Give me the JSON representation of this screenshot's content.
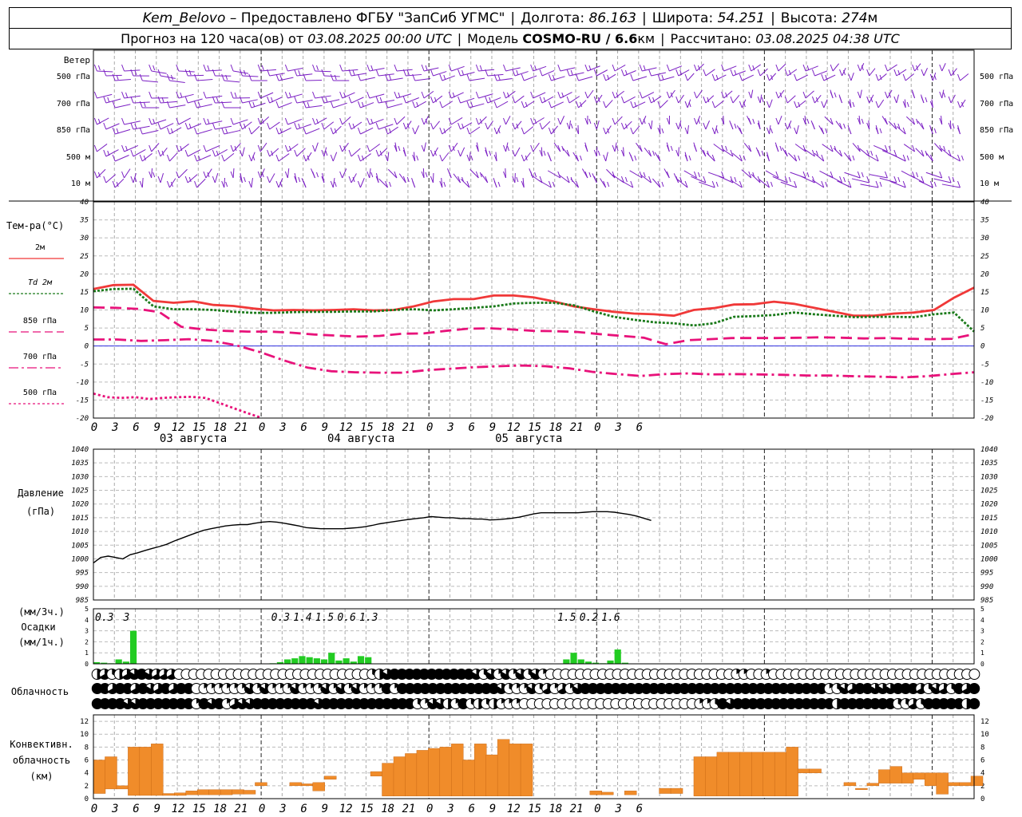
{
  "header": {
    "station": "Kem_Belovo",
    "provided": "– Предоставлено ФГБУ \"ЗапСиб УГМС\"",
    "lon_label": "Долгота:",
    "lon": "86.163",
    "lat_label": "Широта:",
    "lat": "54.251",
    "alt_label": "Высота:",
    "alt": "274",
    "alt_unit": "м",
    "forecast_text": "Прогноз на 120 часа(ов) от",
    "forecast_start": "03.08.2025 00:00 UTC",
    "model_label": "Модель",
    "model": "COSMO-RU / 6.6",
    "model_unit": "км",
    "calc_label": "Рассчитано:",
    "calc_time": "03.08.2025 04:38 UTC"
  },
  "wind_panel": {
    "title": "Ветер",
    "levels": [
      "500 гПа",
      "700 гПа",
      "850 гПа",
      "500 м",
      "10 м"
    ]
  },
  "time_axis": {
    "tick_labels": [
      "0",
      "3",
      "6",
      "9",
      "12",
      "15",
      "18",
      "21",
      "0",
      "3",
      "6",
      "9",
      "12",
      "15",
      "18",
      "21",
      "0",
      "3",
      "6",
      "9",
      "12",
      "15",
      "18",
      "21",
      "0",
      "3",
      "6"
    ],
    "days": [
      "03 августа",
      "04 августа",
      "05 августа"
    ]
  },
  "colors": {
    "wind": "#7b1fc4",
    "t2m": "#f03838",
    "td2m": "#1a7a1a",
    "t850": "#e8127a",
    "t700": "#e8127a",
    "t500": "#e8127a",
    "pressure": "#000000",
    "precip": "#22cc22",
    "conv": "#f08c2a",
    "zero_line": "#3030e0"
  },
  "chart_data": [
    {
      "type": "line",
      "title": "Тем-ра(°C)",
      "x_hours": [
        0,
        3,
        6,
        9,
        12,
        15,
        18,
        21,
        24,
        27,
        30,
        33,
        36,
        39,
        42,
        45,
        48,
        51,
        54,
        57,
        60,
        63,
        66,
        69,
        72,
        75,
        78,
        81,
        84,
        87,
        90,
        93,
        96,
        99,
        102,
        105,
        108,
        111,
        114,
        117,
        120
      ],
      "ylim": [
        -20,
        40
      ],
      "yticks": [
        -20,
        -15,
        -10,
        -5,
        0,
        5,
        10,
        15,
        20,
        25,
        30,
        35,
        40
      ],
      "series": [
        {
          "name": "2м",
          "key": "t2m",
          "values": [
            15.8,
            16.9,
            17.0,
            12.5,
            12.0,
            12.4,
            11.4,
            11.1,
            10.4,
            9.9,
            10.0,
            9.9,
            10.0,
            10.2,
            9.9,
            10.0,
            11.0,
            12.4,
            13.0,
            13.0,
            14.0,
            14.0,
            13.5,
            12.4,
            11.0,
            10.2,
            9.5,
            9.0,
            8.8,
            8.4,
            10.0,
            10.5,
            11.5,
            11.6,
            12.3,
            11.7,
            10.6,
            9.5,
            8.4,
            8.4,
            9.0,
            9.3,
            10.0,
            13.4,
            16.2
          ]
        },
        {
          "name": "Td 2м",
          "key": "td2m",
          "values": [
            15.2,
            15.8,
            15.9,
            11.0,
            10.2,
            10.2,
            10.0,
            9.5,
            9.2,
            9.2,
            9.4,
            9.5,
            9.5,
            9.6,
            9.6,
            10.0,
            10.2,
            9.9,
            10.2,
            10.6,
            11.0,
            11.8,
            12.0,
            12.0,
            11.3,
            9.6,
            8.1,
            7.3,
            6.6,
            6.3,
            5.7,
            6.3,
            8.1,
            8.3,
            8.6,
            9.3,
            8.8,
            8.4,
            8.0,
            8.1,
            8.1,
            8.0,
            8.8,
            9.3,
            4.0
          ]
        },
        {
          "name": "850 гПа",
          "key": "t850",
          "values": [
            10.7,
            10.6,
            10.3,
            9.4,
            5.3,
            4.6,
            4.2,
            4.0,
            4.0,
            3.7,
            3.2,
            2.9,
            2.6,
            2.8,
            3.4,
            3.5,
            4.2,
            4.8,
            4.9,
            4.6,
            4.2,
            4.1,
            3.9,
            3.3,
            2.8,
            2.3,
            0.5,
            1.6,
            1.9,
            2.2,
            2.2,
            2.2,
            2.3,
            2.4,
            2.3,
            2.1,
            2.2,
            2.0,
            1.9,
            2.0,
            3.3
          ]
        },
        {
          "name": "700 гПа",
          "key": "t700",
          "values": [
            1.8,
            1.8,
            1.4,
            1.6,
            1.9,
            1.4,
            0.2,
            -1.7,
            -4.0,
            -6.0,
            -7.0,
            -7.3,
            -7.4,
            -7.4,
            -6.7,
            -6.3,
            -5.9,
            -5.6,
            -5.4,
            -5.6,
            -6.2,
            -7.2,
            -7.8,
            -8.3,
            -7.8,
            -7.6,
            -7.9,
            -7.8,
            -7.9,
            -8.0,
            -8.2,
            -8.2,
            -8.4,
            -8.5,
            -8.7,
            -8.4,
            -7.8,
            -7.3
          ]
        },
        {
          "name": "500 гПа",
          "key": "t500",
          "values": [
            -13.2,
            -14.2,
            -14.4,
            -14.2,
            -14.7,
            -14.4,
            -14.2,
            -14.1,
            -14.4,
            -15.8,
            -17.2,
            -18.6,
            -19.9
          ]
        }
      ]
    },
    {
      "type": "line",
      "title": "Давление (гПа)",
      "ylim": [
        985,
        1040
      ],
      "yticks": [
        985,
        990,
        995,
        1000,
        1005,
        1010,
        1015,
        1020,
        1025,
        1030,
        1035,
        1040
      ],
      "series": [
        {
          "name": "Давление",
          "key": "pressure",
          "x_hours": [
            0,
            1,
            2,
            3,
            4,
            5,
            6,
            7,
            8,
            9,
            10,
            11,
            12,
            13,
            14,
            15,
            16,
            17,
            18,
            19,
            20,
            21,
            22,
            23,
            24,
            25,
            26,
            27,
            28,
            29,
            30,
            31,
            32,
            33,
            34,
            35,
            36,
            37,
            38,
            39,
            40,
            41,
            42,
            43,
            44,
            45,
            46,
            47,
            48,
            49,
            50,
            51,
            52,
            53,
            54,
            55,
            56,
            57,
            58,
            59,
            60,
            61,
            62,
            63,
            64,
            65,
            66,
            67,
            68,
            69,
            70,
            71,
            72,
            73,
            74,
            75,
            76,
            77,
            78,
            79,
            80,
            81,
            82,
            83,
            84,
            85,
            86,
            87,
            88,
            89,
            90,
            91,
            92,
            93,
            94,
            95,
            96,
            97,
            98,
            99,
            100,
            101,
            102,
            103,
            104,
            105,
            106,
            107,
            108,
            109,
            110,
            111,
            112,
            113,
            114,
            115,
            116,
            117,
            118,
            119,
            120
          ],
          "values": [
            998.5,
            1000.5,
            1001.0,
            1000.5,
            1000.0,
            1001.5,
            1002.2,
            1003.0,
            1003.8,
            1004.5,
            1005.3,
            1006.5,
            1007.5,
            1008.5,
            1009.5,
            1010.4,
            1011.0,
            1011.5,
            1012.0,
            1012.3,
            1012.5,
            1012.5,
            1013.0,
            1013.4,
            1013.6,
            1013.4,
            1013.0,
            1012.5,
            1012.0,
            1011.4,
            1011.2,
            1011.0,
            1011.0,
            1011.0,
            1011.0,
            1011.2,
            1011.4,
            1011.7,
            1012.2,
            1012.8,
            1013.2,
            1013.6,
            1014.0,
            1014.4,
            1014.7,
            1015.0,
            1015.4,
            1015.2,
            1015.0,
            1015.0,
            1014.7,
            1014.7,
            1014.5,
            1014.5,
            1014.2,
            1014.3,
            1014.5,
            1014.8,
            1015.2,
            1015.8,
            1016.4,
            1016.8,
            1016.8,
            1016.8,
            1016.8,
            1016.8,
            1016.8,
            1017.0,
            1017.2,
            1017.2,
            1017.2,
            1017.0,
            1016.6,
            1016.2,
            1015.6,
            1014.8,
            1014.0
          ]
        }
      ]
    },
    {
      "type": "bar",
      "title": "Осадки",
      "ylabel_top": "(мм/3ч.)",
      "ylabel_bottom": "(мм/1ч.)",
      "ylim": [
        0,
        5
      ],
      "yticks": [
        0,
        1,
        2,
        3,
        4,
        5
      ],
      "labels_3h": [
        {
          "hour": 1.5,
          "text": "0.3"
        },
        {
          "hour": 4.5,
          "text": "3"
        },
        {
          "hour": 25.5,
          "text": "0.3"
        },
        {
          "hour": 28.5,
          "text": "1.4"
        },
        {
          "hour": 31.5,
          "text": "1.5"
        },
        {
          "hour": 34.5,
          "text": "0.6"
        },
        {
          "hour": 37.5,
          "text": "1.3"
        },
        {
          "hour": 64.5,
          "text": "1.5"
        },
        {
          "hour": 67.5,
          "text": "0.2"
        },
        {
          "hour": 70.5,
          "text": "1.6"
        }
      ],
      "hourly_mm": [
        {
          "hour": 0,
          "value": 0.15
        },
        {
          "hour": 1,
          "value": 0.1
        },
        {
          "hour": 2,
          "value": 0.05
        },
        {
          "hour": 3,
          "value": 0.4
        },
        {
          "hour": 4,
          "value": 0.2
        },
        {
          "hour": 5,
          "value": 3.0
        },
        {
          "hour": 24,
          "value": 0.05
        },
        {
          "hour": 25,
          "value": 0.15
        },
        {
          "hour": 26,
          "value": 0.4
        },
        {
          "hour": 27,
          "value": 0.5
        },
        {
          "hour": 28,
          "value": 0.7
        },
        {
          "hour": 29,
          "value": 0.6
        },
        {
          "hour": 30,
          "value": 0.5
        },
        {
          "hour": 31,
          "value": 0.4
        },
        {
          "hour": 32,
          "value": 1.0
        },
        {
          "hour": 33,
          "value": 0.3
        },
        {
          "hour": 34,
          "value": 0.5
        },
        {
          "hour": 35,
          "value": 0.2
        },
        {
          "hour": 36,
          "value": 0.7
        },
        {
          "hour": 37,
          "value": 0.6
        },
        {
          "hour": 64,
          "value": 0.4
        },
        {
          "hour": 65,
          "value": 1.0
        },
        {
          "hour": 66,
          "value": 0.4
        },
        {
          "hour": 67,
          "value": 0.2
        },
        {
          "hour": 68,
          "value": 0.1
        },
        {
          "hour": 69,
          "value": 0.05
        },
        {
          "hour": 70,
          "value": 0.3
        },
        {
          "hour": 71,
          "value": 1.3
        },
        {
          "hour": 72,
          "value": 0.1
        }
      ]
    },
    {
      "type": "table",
      "title": "Облачность",
      "rows": [
        "34234565444000000000000000000000000002356666666666652515152510000000000000000000000000110010000000000000000000000000000",
        "66466465464660111111515111511151515111616666666666666521152414156666666666666666666666666666666612546655566642542646",
        "66665566666661656145566666666566666666666621553162323111000000000000000000000001126566666666666663666666622426666636"
      ]
    },
    {
      "type": "bar",
      "title": "Конвективн. облачность (км)",
      "ylim": [
        0,
        13
      ],
      "yticks": [
        0,
        2,
        4,
        6,
        8,
        10,
        12
      ],
      "segments": [
        {
          "hour": 0,
          "bottom": 0.8,
          "top": 6.0
        },
        {
          "hour": 1,
          "bottom": 1.5,
          "top": 6.5
        },
        {
          "hour": 2,
          "bottom": 1.5,
          "top": 2.0
        },
        {
          "hour": 3,
          "bottom": 0.5,
          "top": 8.0
        },
        {
          "hour": 4,
          "bottom": 0.5,
          "top": 8.0
        },
        {
          "hour": 5,
          "bottom": 0.5,
          "top": 8.5
        },
        {
          "hour": 6,
          "bottom": 0.5,
          "top": 0.8
        },
        {
          "hour": 7,
          "bottom": 0.5,
          "top": 0.9
        },
        {
          "hour": 8,
          "bottom": 0.6,
          "top": 1.2
        },
        {
          "hour": 9,
          "bottom": 0.6,
          "top": 1.4
        },
        {
          "hour": 10,
          "bottom": 0.6,
          "top": 1.4
        },
        {
          "hour": 11,
          "bottom": 0.6,
          "top": 1.4
        },
        {
          "hour": 12,
          "bottom": 0.7,
          "top": 1.4
        },
        {
          "hour": 13,
          "bottom": 0.7,
          "top": 1.3
        },
        {
          "hour": 14,
          "bottom": 2.0,
          "top": 2.5
        },
        {
          "hour": 17,
          "bottom": 2.0,
          "top": 2.5
        },
        {
          "hour": 18,
          "bottom": 2.0,
          "top": 2.3
        },
        {
          "hour": 19,
          "bottom": 1.2,
          "top": 2.5
        },
        {
          "hour": 20,
          "bottom": 3.0,
          "top": 3.5
        },
        {
          "hour": 24,
          "bottom": 3.5,
          "top": 4.2
        },
        {
          "hour": 25,
          "bottom": 0.4,
          "top": 5.5
        },
        {
          "hour": 26,
          "bottom": 0.4,
          "top": 6.5
        },
        {
          "hour": 27,
          "bottom": 0.4,
          "top": 7.0
        },
        {
          "hour": 28,
          "bottom": 0.4,
          "top": 7.5
        },
        {
          "hour": 29,
          "bottom": 0.4,
          "top": 7.8
        },
        {
          "hour": 30,
          "bottom": 0.4,
          "top": 8.0
        },
        {
          "hour": 31,
          "bottom": 0.4,
          "top": 8.5
        },
        {
          "hour": 32,
          "bottom": 0.4,
          "top": 6.0
        },
        {
          "hour": 33,
          "bottom": 0.4,
          "top": 8.5
        },
        {
          "hour": 34,
          "bottom": 0.4,
          "top": 6.8
        },
        {
          "hour": 35,
          "bottom": 0.4,
          "top": 9.2
        },
        {
          "hour": 36,
          "bottom": 0.4,
          "top": 8.5
        },
        {
          "hour": 37,
          "bottom": 0.4,
          "top": 8.5
        },
        {
          "hour": 43,
          "bottom": 0.6,
          "top": 1.2
        },
        {
          "hour": 44,
          "bottom": 0.6,
          "top": 1.0
        },
        {
          "hour": 46,
          "bottom": 0.6,
          "top": 1.2
        },
        {
          "hour": 49,
          "bottom": 0.8,
          "top": 1.6
        },
        {
          "hour": 50,
          "bottom": 0.8,
          "top": 1.6
        },
        {
          "hour": 52,
          "bottom": 0.4,
          "top": 6.5
        },
        {
          "hour": 53,
          "bottom": 0.4,
          "top": 6.5
        },
        {
          "hour": 54,
          "bottom": 0.4,
          "top": 7.2
        },
        {
          "hour": 55,
          "bottom": 0.4,
          "top": 7.2
        },
        {
          "hour": 56,
          "bottom": 0.4,
          "top": 7.2
        },
        {
          "hour": 57,
          "bottom": 0.4,
          "top": 7.2
        },
        {
          "hour": 58,
          "bottom": 0.4,
          "top": 7.2
        },
        {
          "hour": 59,
          "bottom": 0.4,
          "top": 7.2
        },
        {
          "hour": 60,
          "bottom": 0.4,
          "top": 8.0
        },
        {
          "hour": 61,
          "bottom": 4.0,
          "top": 4.6
        },
        {
          "hour": 62,
          "bottom": 4.0,
          "top": 4.6
        },
        {
          "hour": 65,
          "bottom": 2.0,
          "top": 2.5
        },
        {
          "hour": 66,
          "bottom": 1.4,
          "top": 1.6
        },
        {
          "hour": 67,
          "bottom": 2.0,
          "top": 2.4
        },
        {
          "hour": 68,
          "bottom": 2.4,
          "top": 4.5
        },
        {
          "hour": 69,
          "bottom": 2.4,
          "top": 5.0
        },
        {
          "hour": 70,
          "bottom": 2.4,
          "top": 4.0
        },
        {
          "hour": 71,
          "bottom": 3.0,
          "top": 4.0
        },
        {
          "hour": 72,
          "bottom": 2.0,
          "top": 4.0
        },
        {
          "hour": 73,
          "bottom": 0.7,
          "top": 4.0
        },
        {
          "hour": 74,
          "bottom": 2.0,
          "top": 2.5
        },
        {
          "hour": 75,
          "bottom": 2.0,
          "top": 2.5
        },
        {
          "hour": 76,
          "bottom": 2.0,
          "top": 3.5
        }
      ]
    }
  ]
}
